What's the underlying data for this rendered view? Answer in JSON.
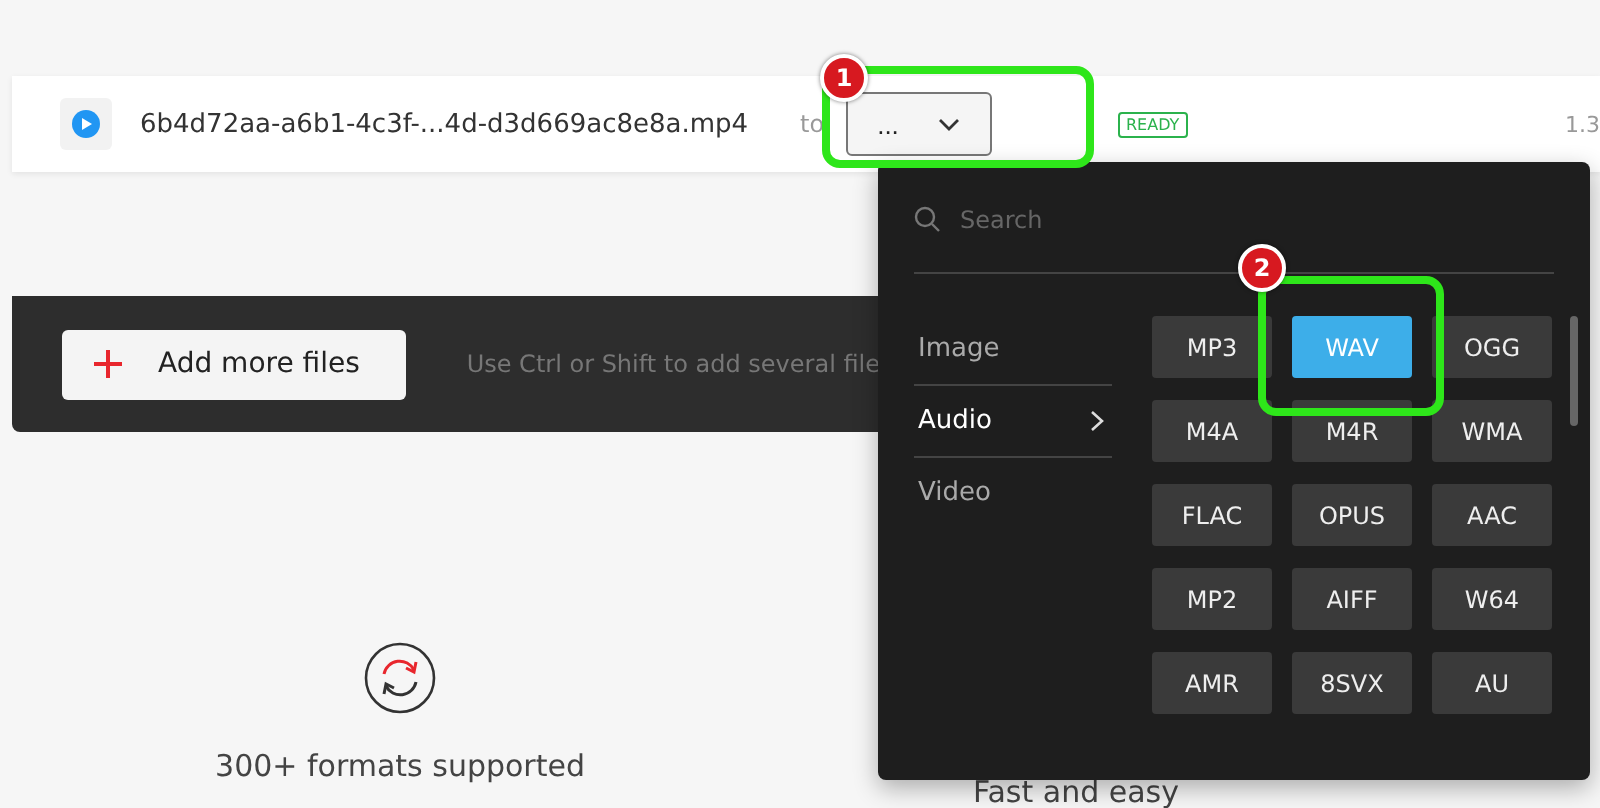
{
  "file_row": {
    "filename": "6b4d72aa-a6b1-4c3f-...4d-d3d669ac8e8a.mp4",
    "to_label": "to",
    "format_button": "...",
    "status": "READY",
    "size": "1.3"
  },
  "upload_bar": {
    "add_button": "Add more files",
    "hint": "Use Ctrl or Shift to add several file"
  },
  "features": [
    {
      "text": "300+ formats supported"
    },
    {
      "text": "Fast and easy"
    }
  ],
  "format_menu": {
    "search": {
      "placeholder": "Search"
    },
    "categories": [
      {
        "label": "Image",
        "selected": false
      },
      {
        "label": "Audio",
        "selected": true
      },
      {
        "label": "Video",
        "selected": false
      }
    ],
    "formats": [
      {
        "label": "MP3",
        "selected": false
      },
      {
        "label": "WAV",
        "selected": true
      },
      {
        "label": "OGG",
        "selected": false
      },
      {
        "label": "M4A",
        "selected": false
      },
      {
        "label": "M4R",
        "selected": false
      },
      {
        "label": "WMA",
        "selected": false
      },
      {
        "label": "FLAC",
        "selected": false
      },
      {
        "label": "OPUS",
        "selected": false
      },
      {
        "label": "AAC",
        "selected": false
      },
      {
        "label": "MP2",
        "selected": false
      },
      {
        "label": "AIFF",
        "selected": false
      },
      {
        "label": "W64",
        "selected": false
      },
      {
        "label": "AMR",
        "selected": false
      },
      {
        "label": "8SVX",
        "selected": false
      },
      {
        "label": "AU",
        "selected": false
      }
    ]
  },
  "annotations": [
    {
      "label": "1"
    },
    {
      "label": "2"
    }
  ]
}
